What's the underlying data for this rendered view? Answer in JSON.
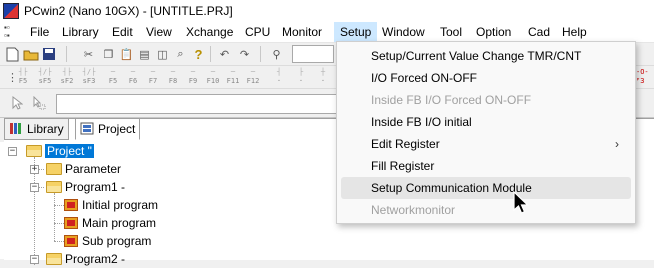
{
  "window": {
    "title": "PCwin2 (Nano 10GX) - [UNTITLE.PRJ]"
  },
  "menubar": {
    "items": [
      "File",
      "Library",
      "Edit",
      "View",
      "Xchange",
      "CPU",
      "Monitor",
      "Setup",
      "Window",
      "Tool",
      "Option",
      "Cad",
      "Help"
    ],
    "active": "Setup"
  },
  "toolbar2": {
    "fkeys": [
      "F5",
      "F6",
      "F7",
      "F8",
      "F9",
      "F10",
      "F11",
      "F12"
    ]
  },
  "tabs": [
    {
      "label": "Library"
    },
    {
      "label": "Project"
    }
  ],
  "tree": {
    "root": "Project \"",
    "items": {
      "parameter": "Parameter",
      "program1": "Program1 -",
      "initial": "Initial program",
      "main": "Main program",
      "sub": "Sub program",
      "program2": "Program2 -"
    }
  },
  "setup_menu": {
    "items": [
      {
        "label": "Setup/Current Value Change TMR/CNT",
        "enabled": true
      },
      {
        "label": "I/O Forced ON-OFF",
        "enabled": true
      },
      {
        "label": "Inside FB I/O Forced ON-OFF",
        "enabled": false
      },
      {
        "label": "Inside FB I/O initial",
        "enabled": true
      },
      {
        "label": "Edit Register",
        "enabled": true,
        "submenu": true
      },
      {
        "label": "Fill Register",
        "enabled": true
      },
      {
        "label": "Setup Communication Module",
        "enabled": true,
        "hovered": true
      },
      {
        "label": "Networkmonitor",
        "enabled": false
      }
    ]
  },
  "colors": {
    "selection": "#0078d7",
    "menu_active": "#cde8ff",
    "folder": "#f6d266"
  }
}
